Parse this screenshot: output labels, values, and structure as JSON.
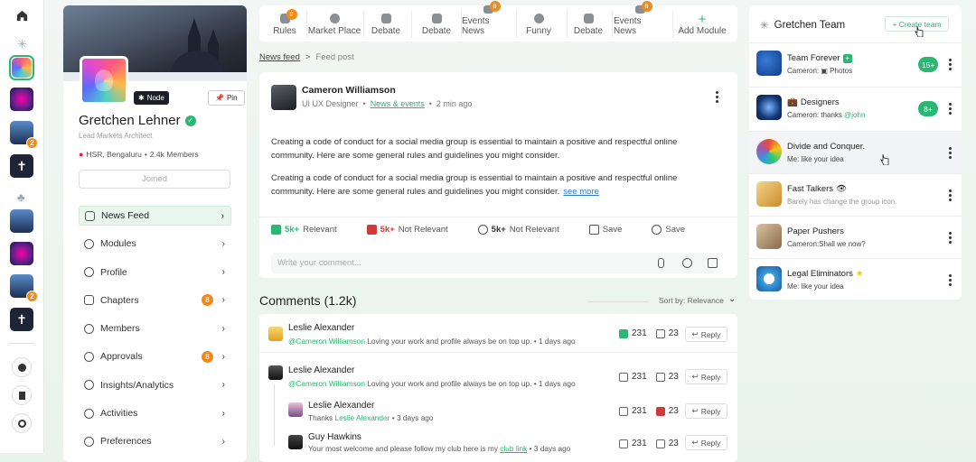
{
  "rail": {
    "items": [
      {
        "name": "home"
      },
      {
        "name": "group-1"
      },
      {
        "name": "group-2"
      },
      {
        "name": "group-3",
        "badge": "2"
      },
      {
        "name": "group-4"
      },
      {
        "name": "group-5"
      },
      {
        "name": "group-6"
      },
      {
        "name": "group-7",
        "badge": "2"
      },
      {
        "name": "group-8"
      }
    ]
  },
  "profile": {
    "name": "Gretchen Lehner",
    "subtitle": "Lead Markets Architect",
    "location": "HSR, Bengaluru",
    "members": "2.4k Members",
    "node_label": "Node",
    "pin_label": "Pin",
    "joined_label": "Joined",
    "nav": [
      {
        "label": "News Feed",
        "active": true
      },
      {
        "label": "Modules"
      },
      {
        "label": "Profile"
      },
      {
        "label": "Chapters",
        "count": "8"
      },
      {
        "label": "Members"
      },
      {
        "label": "Approvals",
        "count": "8"
      },
      {
        "label": "Insights/Analytics"
      },
      {
        "label": "Activities"
      },
      {
        "label": "Preferences"
      }
    ]
  },
  "tabs": [
    {
      "label": "Rules",
      "badge": "8"
    },
    {
      "label": "Market Place"
    },
    {
      "label": "Debate"
    },
    {
      "label": "Debate"
    },
    {
      "label": "Events News",
      "badge": "8"
    },
    {
      "label": "Funny"
    },
    {
      "label": "Debate"
    },
    {
      "label": "Events News",
      "badge": "8"
    },
    {
      "label": "Add Module"
    }
  ],
  "breadcrumb": {
    "parent": "News feed",
    "separator": ">",
    "current": "Feed post"
  },
  "post": {
    "author": "Cameron Williamson",
    "role": "UI UX Designer",
    "category": "News & events",
    "time": "2 min ago",
    "para1": "Creating a code of conduct for a social media group is essential to maintain a positive and respectful online community. Here are some general rules and guidelines you might consider.",
    "para2": "Creating a code of conduct for a social media group is essential to maintain a positive and respectful online community. Here are some general rules and guidelines you might consider.",
    "see_more": "see more",
    "actions": [
      {
        "count": "5k+",
        "label": "Relevant"
      },
      {
        "count": "5k+",
        "label": "Not Relevant"
      },
      {
        "count": "5k+",
        "label": "Not Relevant"
      },
      {
        "label": "Save"
      },
      {
        "label": "Save"
      }
    ],
    "comment_placeholder": "Write your comment..."
  },
  "comments": {
    "title": "Comments (1.2k)",
    "sort": "Sort by: Relevance",
    "items": [
      {
        "name": "Leslie Alexander",
        "mention": "@Cameron Williamson",
        "text": "Loving your work and profile always be on top up.",
        "time": "1 days ago",
        "up": "231",
        "down": "23",
        "reply": "Reply"
      },
      {
        "name": "Leslie Alexander",
        "mention": "@Cameron Williamson",
        "text": "Loving your work and profile always be on top up.",
        "time": "1 days ago",
        "up": "231",
        "down": "23",
        "reply": "Reply"
      },
      {
        "name": "Leslie Alexander",
        "prefix": "Thanks",
        "mention": "Leslie Alexander",
        "time": "3 days ago",
        "up": "231",
        "down": "23",
        "reply": "Reply"
      },
      {
        "name": "Guy Hawkins",
        "text": "Your most welcome and please follow my club here is my",
        "link": "club link",
        "time": "3 days ago",
        "up": "231",
        "down": "23",
        "reply": "Reply"
      }
    ]
  },
  "team": {
    "title": "Gretchen Team",
    "create_label": "+ Create team",
    "rows": [
      {
        "name": "Team Forever",
        "sub_prefix": "Cameron:",
        "sub": "Photos",
        "count": "15+"
      },
      {
        "name": "Designers",
        "sub": "Cameron: thanks",
        "mention": "@john",
        "count": "8+"
      },
      {
        "name": "Divide and Conquer.",
        "sub": "Me: like your idea"
      },
      {
        "name": "Fast Talkers",
        "sub": "Barely has change the group icon."
      },
      {
        "name": "Paper Pushers",
        "sub": "Cameron:Shall we now?"
      },
      {
        "name": "Legal Eliminators",
        "sub": "Me: like your idea"
      }
    ]
  },
  "colors": {
    "accent": "#2bb673",
    "badge": "#f28a1a",
    "danger": "#d13a3a"
  }
}
